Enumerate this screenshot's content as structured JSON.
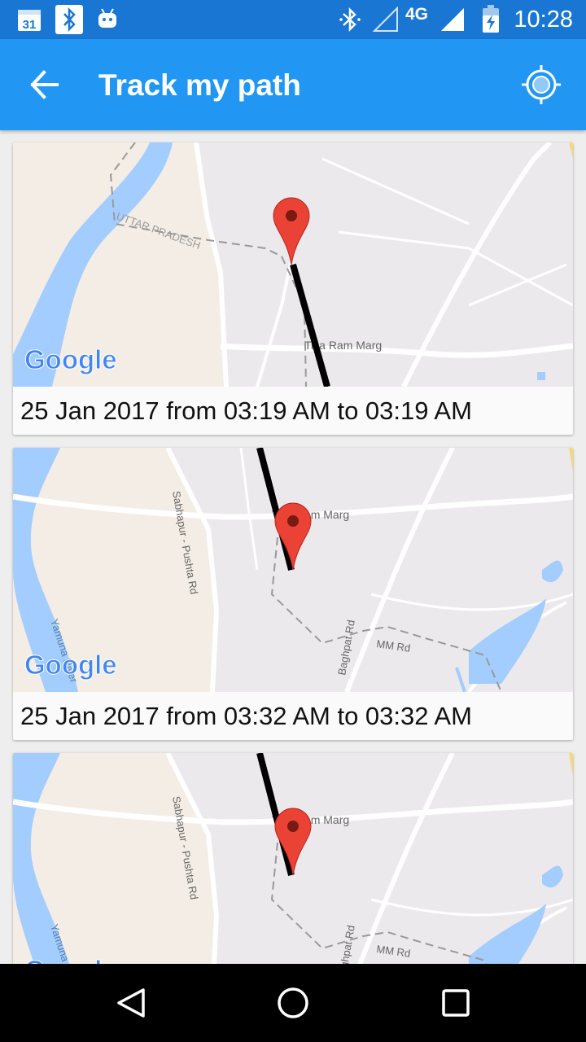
{
  "status_bar": {
    "time": "10:28",
    "network": "4G",
    "calendar_date": "31",
    "icons": [
      "calendar-icon",
      "bluetooth-icon",
      "android-icon",
      "bluetooth-icon",
      "signal-icon",
      "battery-charging-icon"
    ]
  },
  "app_bar": {
    "title": "Track my path",
    "back_icon": "arrow-back-icon",
    "action_icon": "my-location-icon",
    "color": "#2196f3"
  },
  "map_labels": {
    "google": "Google",
    "state": "UTTAR PRADESH",
    "road_tika_ram": "Tika Ram Marg",
    "road_sabhapur": "Sabhapur - Pushta Rd",
    "road_baghpat": "Baghpat Rd",
    "road_mm": "MM Rd",
    "river": "Yamuna River"
  },
  "tracks": [
    {
      "caption": "25 Jan 2017 from 03:19 AM to 03:19 AM"
    },
    {
      "caption": "25 Jan 2017 from 03:32 AM to 03:32 AM"
    },
    {
      "caption": ""
    }
  ],
  "nav_bar": {
    "icons": [
      "back-triangle-icon",
      "home-circle-icon",
      "recents-square-icon"
    ]
  },
  "colors": {
    "status_bar": "#1976d2",
    "map_land": "#ece9ec",
    "map_sand": "#f3ede5",
    "water": "#a3ccff",
    "marker": "#ea4335",
    "path": "#000000"
  }
}
